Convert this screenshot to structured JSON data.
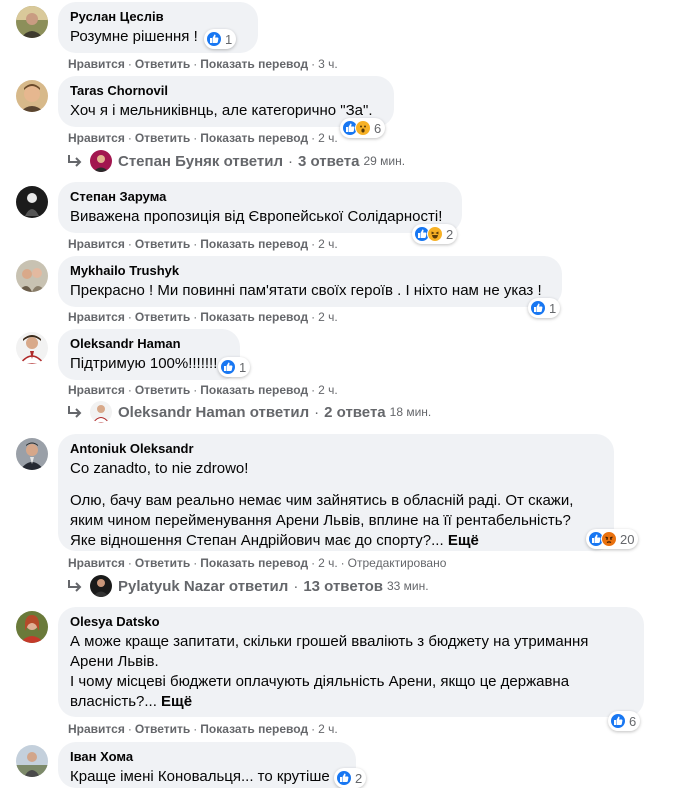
{
  "actions": {
    "like": "Нравится",
    "reply": "Ответить",
    "translate": "Показать перевод",
    "edited": "Отредактировано",
    "sep": "·"
  },
  "comments": [
    {
      "author": "Руслан Цеслів",
      "lines": [
        "Розумне рішення !"
      ],
      "reactions": [
        "like"
      ],
      "reaction_count": "1",
      "time": "3 ч."
    },
    {
      "author": "Taras Chornovil",
      "lines": [
        "Хоч я і мельниківнць, але категорично \"За\"."
      ],
      "reactions": [
        "like",
        "wow"
      ],
      "reaction_count": "6",
      "time": "2 ч.",
      "reply_summary": {
        "name": "Степан Буняк",
        "verb": "ответил",
        "count": "3 ответа",
        "ago": "29 мин."
      }
    },
    {
      "author": "Степан Зарума",
      "lines": [
        "Виважена пропозиція від Європейської Солідарності!"
      ],
      "reactions": [
        "like",
        "haha"
      ],
      "reaction_count": "2",
      "time": "2 ч."
    },
    {
      "author": "Mykhailo Trushyk",
      "lines": [
        "Прекрасно ! Ми повинні пам'ятати своїх героїв . І ніхто нам не указ !"
      ],
      "reactions": [
        "like"
      ],
      "reaction_count": "1",
      "time": "2 ч."
    },
    {
      "author": "Oleksandr Haman",
      "lines": [
        "Підтримую 100%!!!!!!!"
      ],
      "reactions": [
        "like"
      ],
      "reaction_count": "1",
      "time": "2 ч.",
      "reply_summary": {
        "name": "Oleksandr Haman",
        "verb": "ответил",
        "count": "2 ответа",
        "ago": "18 мин."
      }
    },
    {
      "author": "Antoniuk Oleksandr",
      "lines": [
        "Co zanadto, to nie zdrowo!",
        "Олю, бачу вам реально немає чим зайнятись в обласній раді. От скажи,",
        "яким чином перейменування Арени Львів, вплине на її рентабельність?",
        "Яке відношення Степан Андрійович має до спорту?..."
      ],
      "more": "Ещё",
      "reactions": [
        "like",
        "angry"
      ],
      "reaction_count": "20",
      "time": "2 ч.",
      "edited": true,
      "reply_summary": {
        "name": "Pylatyuk Nazar",
        "verb": "ответил",
        "count": "13 ответов",
        "ago": "33 мин."
      }
    },
    {
      "author": "Olesya Datsko",
      "lines": [
        "А може краще запитати, скільки грошей вваліють з бюджету на утримання",
        "Арени Львів.",
        "І чому місцеві бюджети оплачують діяльність Арени, якщо це державна",
        "власність?..."
      ],
      "more": "Ещё",
      "reactions": [
        "like"
      ],
      "reaction_count": "6",
      "time": "2 ч."
    },
    {
      "author": "Іван Хома",
      "lines": [
        "Краще імені Коновальця... то крутіше"
      ],
      "reactions": [
        "like"
      ],
      "reaction_count": "2",
      "time": ""
    }
  ]
}
